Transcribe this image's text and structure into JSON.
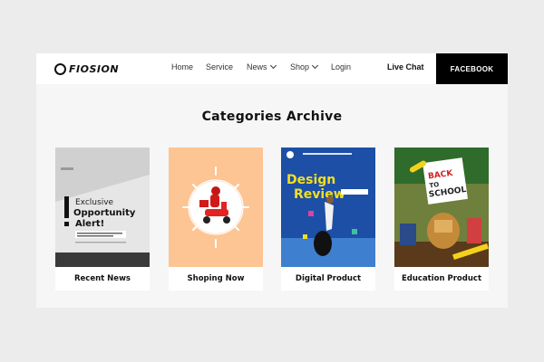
{
  "brand": {
    "name": "FIOSION"
  },
  "nav": {
    "items": [
      {
        "label": "Home",
        "has_dropdown": false
      },
      {
        "label": "Service",
        "has_dropdown": false
      },
      {
        "label": "News",
        "has_dropdown": true
      },
      {
        "label": "Shop",
        "has_dropdown": true
      },
      {
        "label": "Login",
        "has_dropdown": false
      }
    ],
    "live_chat": "Live Chat",
    "cta": "FACEBOOK"
  },
  "page": {
    "title": "Categories Archive"
  },
  "categories": [
    {
      "label": "Recent News",
      "image": {
        "heading": "Exclusive Opportunity Alert!"
      }
    },
    {
      "label": "Shoping Now",
      "image": {
        "icon": "scooter-delivery-icon"
      }
    },
    {
      "label": "Digital Product",
      "image": {
        "heading": "Design Review"
      }
    },
    {
      "label": "Education Product",
      "image": {
        "heading": "BACK TO SCHOOL"
      }
    }
  ],
  "colors": {
    "header_bg": "#ffffff",
    "cta_bg": "#000000",
    "page_bg": "#f6f6f6",
    "outer_bg": "#ececec"
  }
}
